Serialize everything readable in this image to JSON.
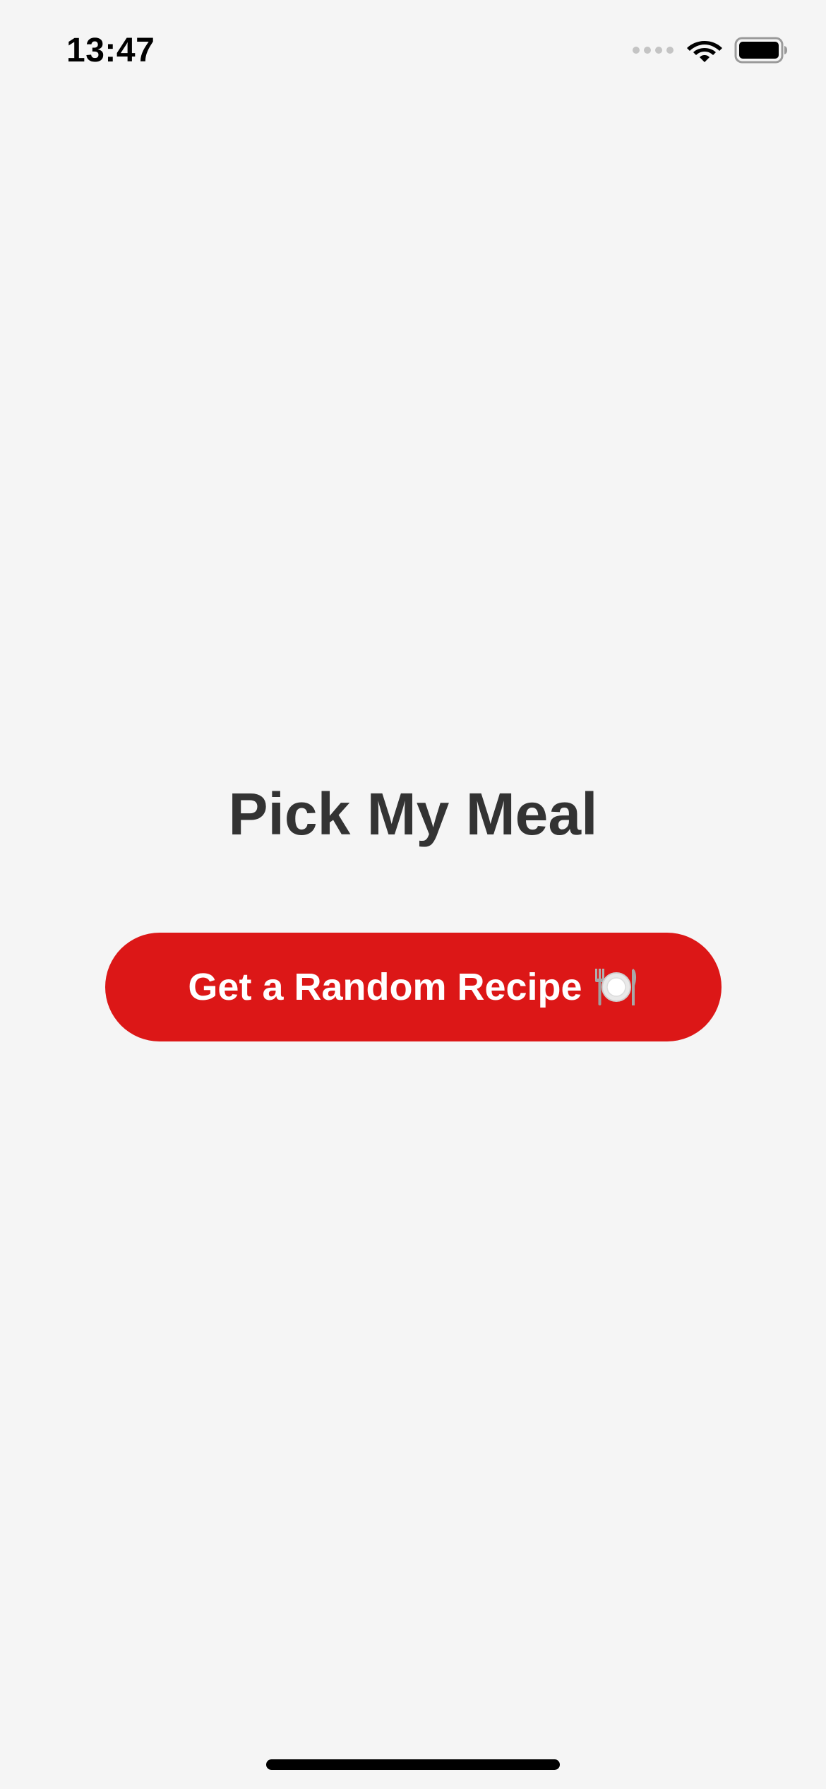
{
  "status_bar": {
    "time": "13:47",
    "icons": [
      "signal-dots-icon",
      "wifi-icon",
      "battery-icon"
    ]
  },
  "main": {
    "title": "Pick My Meal",
    "cta_button": {
      "label": "Get a Random Recipe",
      "icon": "plate-cutlery-icon",
      "background_color": "#dc1717",
      "text_color": "#ffffff"
    }
  },
  "colors": {
    "background": "#f5f5f5",
    "title_text": "#333333",
    "accent": "#dc1717"
  }
}
